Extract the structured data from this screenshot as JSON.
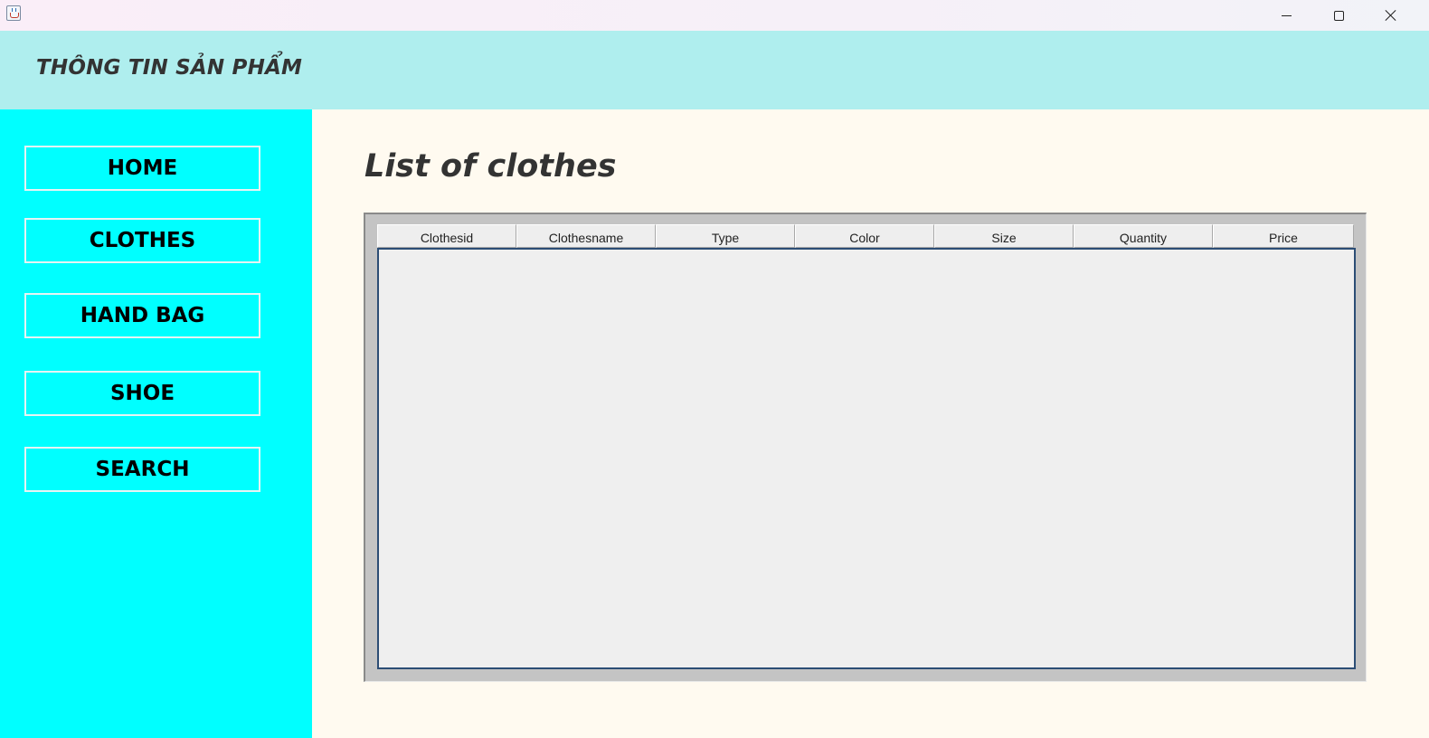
{
  "window": {
    "controls": {
      "minimize_icon": "minimize-icon",
      "maximize_icon": "maximize-icon",
      "close_icon": "close-icon"
    }
  },
  "header": {
    "title": "THÔNG TIN SẢN PHẨM",
    "background": "#afeeee"
  },
  "sidebar": {
    "background": "#00ffff",
    "items": [
      {
        "label": "HOME"
      },
      {
        "label": "CLOTHES"
      },
      {
        "label": "HAND BAG"
      },
      {
        "label": "SHOE"
      },
      {
        "label": "SEARCH"
      }
    ]
  },
  "main": {
    "title": "List of clothes",
    "background": "#fffaf0",
    "table": {
      "columns": [
        "Clothesid",
        "Clothesname",
        "Type",
        "Color",
        "Size",
        "Quantity",
        "Price"
      ],
      "rows": []
    }
  }
}
